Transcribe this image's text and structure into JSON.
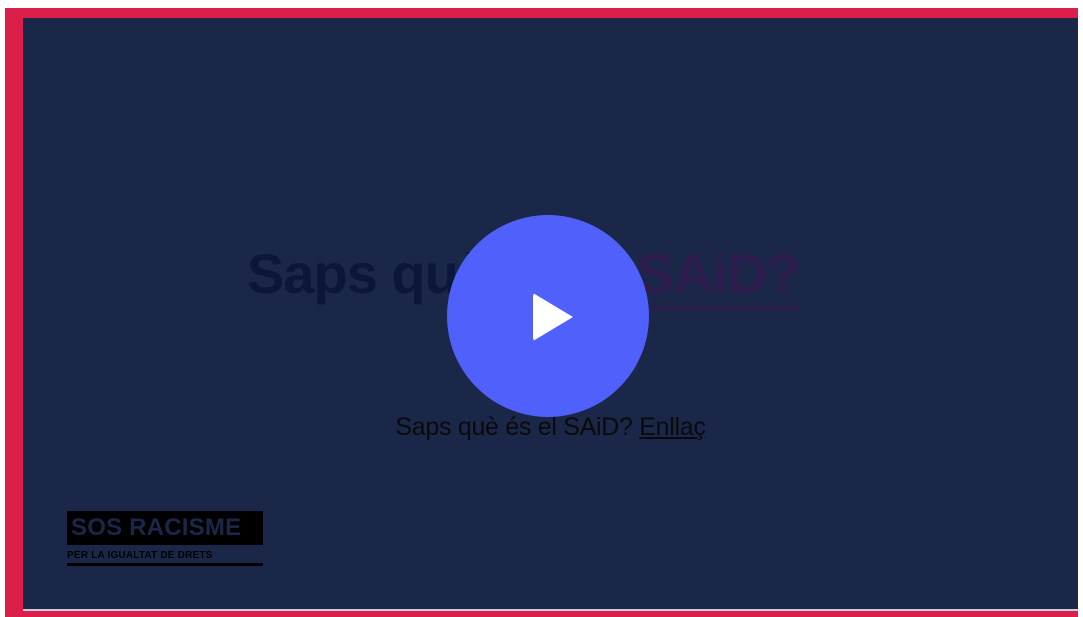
{
  "video": {
    "headline_main": "Saps què és el ",
    "headline_highlight": "SAiD?",
    "play_icon": "play-icon",
    "caption_text": "Saps què és el SAiD? ",
    "caption_link": "Enllaç"
  },
  "logo": {
    "name": "SOS RACISME",
    "tagline": "PER LA IGUALTAT DE DRETS"
  },
  "colors": {
    "frame_border": "#dc1e4b",
    "video_background": "#1b2748",
    "play_button": "#5060fb"
  }
}
